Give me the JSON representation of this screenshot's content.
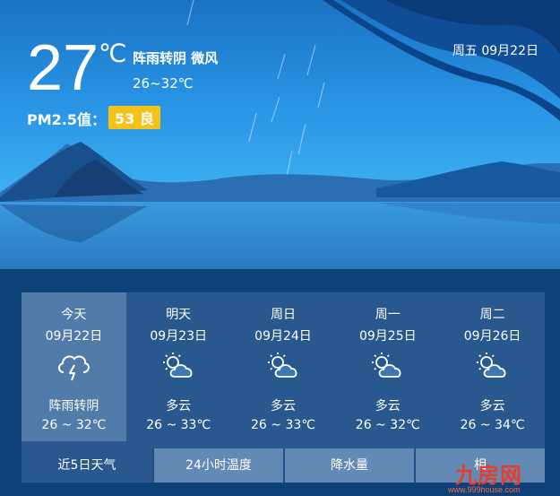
{
  "current": {
    "temperature": "27",
    "unit": "℃",
    "condition": "阵雨转阴 微风",
    "range": "26~32℃",
    "pm_label": "PM2.5值：",
    "pm_value": "53 良",
    "date": "周五 09月22日"
  },
  "forecast": [
    {
      "label": "今天",
      "date": "09月22日",
      "icon": "thunderstorm-icon",
      "condition": "阵雨转阴",
      "range": "26 ~ 32℃"
    },
    {
      "label": "明天",
      "date": "09月23日",
      "icon": "partly-cloudy-icon",
      "condition": "多云",
      "range": "26 ~ 33℃"
    },
    {
      "label": "周日",
      "date": "09月24日",
      "icon": "partly-cloudy-icon",
      "condition": "多云",
      "range": "26 ~ 33℃"
    },
    {
      "label": "周一",
      "date": "09月25日",
      "icon": "partly-cloudy-icon",
      "condition": "多云",
      "range": "26 ~ 32℃"
    },
    {
      "label": "周二",
      "date": "09月26日",
      "icon": "partly-cloudy-icon",
      "condition": "多云",
      "range": "26 ~ 34℃"
    }
  ],
  "tabs": [
    {
      "label": "近5日天气"
    },
    {
      "label": "24小时温度"
    },
    {
      "label": "降水量"
    },
    {
      "label": "相"
    }
  ],
  "watermark": {
    "text": "九房网",
    "url": "www.999house.com"
  },
  "colors": {
    "pm_badge": "#f5c318",
    "sky_top": "#1b7fd0",
    "sky_bottom": "#0d3e77"
  }
}
